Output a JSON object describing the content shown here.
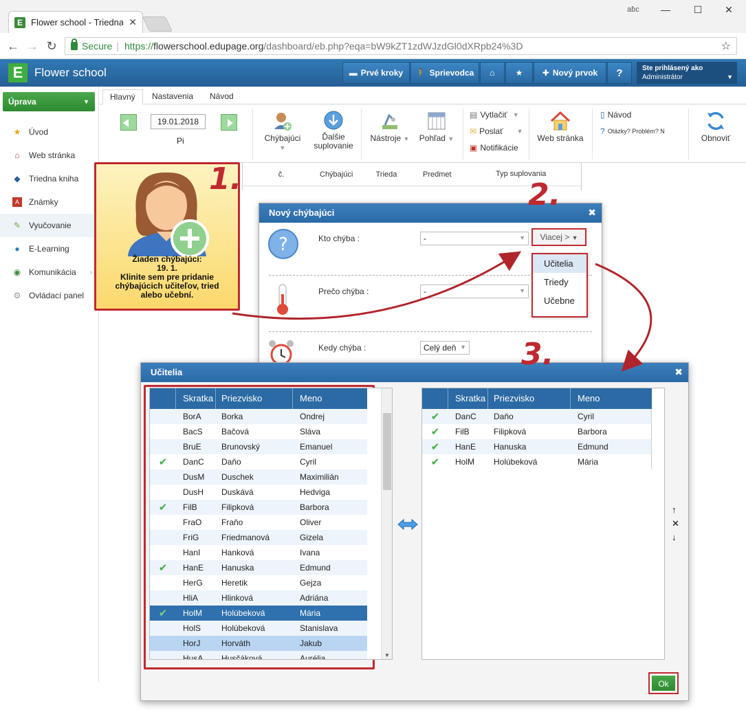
{
  "browser": {
    "tab_title": "Flower school - Triedna k",
    "profile": "аɓс",
    "secure": "Secure",
    "url_scheme": "https://",
    "url_host": "flowerschool.edupage.org",
    "url_path": "/dashboard/eb.php?eqa=bW9kZT1zdWJzdGl0dXRpb24%3D",
    "minimize": "—",
    "maximize": "☐",
    "close": "✕"
  },
  "header": {
    "app_name": "Flower school",
    "logo": "E",
    "btn_first_steps": "Prvé kroky",
    "btn_guide": "Sprievodca",
    "btn_new_item": "Nový prvok",
    "btn_help": "?",
    "user_label": "Ste prihlásený ako",
    "user_name": "Administrátor"
  },
  "sidebar": {
    "top_button": "Úprava",
    "items": [
      {
        "label": "Úvod",
        "icon": "star-icon"
      },
      {
        "label": "Web stránka",
        "icon": "web-icon"
      },
      {
        "label": "Triedna kniha",
        "icon": "book-icon"
      },
      {
        "label": "Známky",
        "icon": "grades-icon"
      },
      {
        "label": "Vyučovanie",
        "icon": "teaching-icon"
      },
      {
        "label": "E-Learning",
        "icon": "elearning-icon"
      },
      {
        "label": "Komunikácia",
        "icon": "globe-icon"
      },
      {
        "label": "Ovládací panel",
        "icon": "gear-icon"
      }
    ]
  },
  "ribbon": {
    "tabs": [
      "Hlavný",
      "Nastavenia",
      "Návod"
    ],
    "date": "19.01.2018",
    "day": "Pi",
    "absent": "Chýbajúci",
    "next_sub_1": "Ďalšie",
    "next_sub_2": "suplovanie",
    "tools": "Nástroje",
    "view": "Pohľad",
    "print": "Vytlačiť",
    "send": "Poslať",
    "notifications": "Notifikácie",
    "website": "Web stránka",
    "guide": "Návod",
    "questions": "Otázky? Problém? N",
    "refresh": "Obnoviť"
  },
  "grid": {
    "cols": [
      "č.",
      "Chýbajúci",
      "Trieda",
      "Predmet",
      "Typ suplovania"
    ]
  },
  "card": {
    "step": "1.",
    "line1": "Žiaden chýbajúci:",
    "line2": "19. 1.",
    "line3": "Klinite sem pre pridanie",
    "line4": "chýbajúcich učiteľov, tried",
    "line5": "alebo učební."
  },
  "dialog_absent": {
    "title": "Nový chýbajúci",
    "step": "2.",
    "who_label": "Kto chýba :",
    "who_value": "-",
    "more": "Viacej >",
    "why_label": "Prečo chýba :",
    "why_value": "-",
    "when_label": "Kedy chýba :",
    "when_value": "Celý deň",
    "menu": [
      "Učitelia",
      "Triedy",
      "Učebne"
    ]
  },
  "dialog_teachers": {
    "title": "Učitelia",
    "step": "3.",
    "headers": [
      "Skratka",
      "Priezvisko",
      "Meno"
    ],
    "left_rows": [
      {
        "abbr": "BorA",
        "last": "Borka",
        "first": "Ondrej",
        "checked": false
      },
      {
        "abbr": "BacS",
        "last": "Bačová",
        "first": "Sláva",
        "checked": false
      },
      {
        "abbr": "BruE",
        "last": "Brunovský",
        "first": "Emanuel",
        "checked": false
      },
      {
        "abbr": "DanC",
        "last": "Daňo",
        "first": "Cyril",
        "checked": true
      },
      {
        "abbr": "DusM",
        "last": "Duschek",
        "first": "Maximilián",
        "checked": false
      },
      {
        "abbr": "DusH",
        "last": "Duskává",
        "first": "Hedviga",
        "checked": false
      },
      {
        "abbr": "FilB",
        "last": "Filipková",
        "first": "Barbora",
        "checked": true
      },
      {
        "abbr": "FraO",
        "last": "Fraňo",
        "first": "Oliver",
        "checked": false
      },
      {
        "abbr": "FriG",
        "last": "Friedmanová",
        "first": "Gizela",
        "checked": false
      },
      {
        "abbr": "HanI",
        "last": "Hanková",
        "first": "Ivana",
        "checked": false
      },
      {
        "abbr": "HanE",
        "last": "Hanuska",
        "first": "Edmund",
        "checked": true
      },
      {
        "abbr": "HerG",
        "last": "Heretik",
        "first": "Gejza",
        "checked": false
      },
      {
        "abbr": "HliA",
        "last": "Hlinková",
        "first": "Adriána",
        "checked": false
      },
      {
        "abbr": "HolM",
        "last": "Holúbeková",
        "first": "Mária",
        "checked": true
      },
      {
        "abbr": "HolS",
        "last": "Holúbeková",
        "first": "Stanislava",
        "checked": false
      },
      {
        "abbr": "HorJ",
        "last": "Horváth",
        "first": "Jakub",
        "checked": false
      },
      {
        "abbr": "HusA",
        "last": "Husčáková",
        "first": "Aurélia",
        "checked": false
      }
    ],
    "right_rows": [
      {
        "abbr": "DanC",
        "last": "Daňo",
        "first": "Cyril"
      },
      {
        "abbr": "FilB",
        "last": "Filipková",
        "first": "Barbora"
      },
      {
        "abbr": "HanE",
        "last": "Hanuska",
        "first": "Edmund"
      },
      {
        "abbr": "HolM",
        "last": "Holúbeková",
        "first": "Mária"
      }
    ],
    "ok": "Ok",
    "check": "✔"
  }
}
